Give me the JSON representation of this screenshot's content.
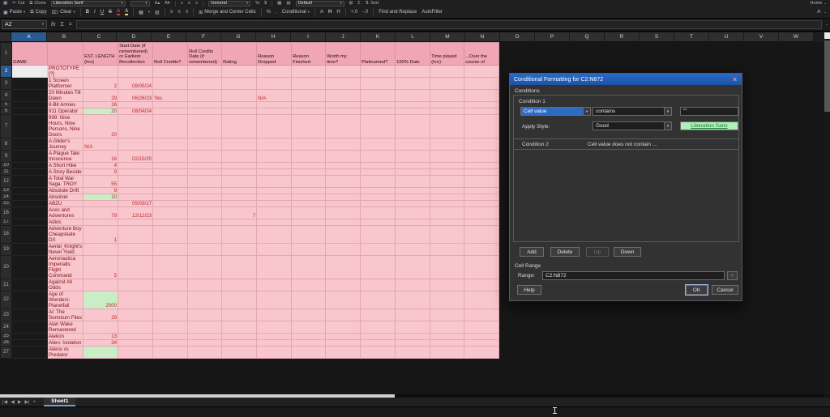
{
  "icons": {
    "grid": "▦",
    "cut": "✂",
    "clone": "⧉",
    "paste": "▣",
    "copy": "⧉",
    "clear": "⌦",
    "bold": "B",
    "italic": "I",
    "underline": "U",
    "strike": "S",
    "font_color": "A",
    "highlight": "A",
    "borders": "▦",
    "borders2": "▤",
    "merge_icon": "⊞",
    "align_left": "≡",
    "align_center": "≡",
    "align_right": "≡",
    "percent": "%",
    "comma": ",",
    "currency": "$",
    "sigma": "Σ",
    "sort": "⇅",
    "grow": "A▴",
    "shrink_font": "A▾",
    "add_decimal": "+.0",
    "del_decimal": "-.0",
    "chev": "▾",
    "chev2": "⌄",
    "fx": "fx",
    "eq": "=",
    "nav_first": "|◀",
    "nav_prev": "◀",
    "nav_next": "▶",
    "nav_last": "▶|",
    "add_sheet": "+",
    "close": "×",
    "shrink": "▫",
    "styleA": "A",
    "styleH1": "H",
    "styleH2": "H"
  },
  "toolbar1": {
    "cut": "Cut",
    "clone": "Clone",
    "font_name": "Liberation Serif",
    "font_size": "",
    "number_format": "General",
    "cell_style": "Default",
    "sort": "Sort",
    "home": "Home"
  },
  "toolbar2": {
    "paste": "Paste",
    "copy": "Copy",
    "clear": "Clear",
    "merge": "Merge and Center Cells",
    "conditional": "Conditional",
    "find_replace": "Find and Replace",
    "autofilter": "AutoFilter"
  },
  "formula_bar": {
    "name_box": "A2"
  },
  "sheet": {
    "selected_col": "A",
    "selected_row": "2",
    "col_letters": [
      "A",
      "B",
      "C",
      "D",
      "E",
      "F",
      "G",
      "H",
      "I",
      "J",
      "K",
      "L",
      "M",
      "N",
      "O",
      "P",
      "Q",
      "R",
      "S",
      "T",
      "U",
      "V",
      "W"
    ],
    "col_headers": [
      "GAME",
      "",
      "EST. LENGTH (hrs)",
      "Start Date (if remembered) or Earliest Recollection",
      "Roll Credits?",
      "Roll Credits Date (if remembered)",
      "Rating",
      "Reason Dropped",
      "Reason Finished",
      "Worth my time?",
      "Platinumed?",
      "100% Date",
      "Time played (hrs)",
      "...Over the course of"
    ],
    "rows": [
      {
        "n": "2",
        "name": "PROTOTYPE [?]"
      },
      {
        "n": "3",
        "name": "1 Screen Platformer",
        "est": "2",
        "start": "08/05/24"
      },
      {
        "n": "4",
        "name": "20 Minutes Till Dawn",
        "est": "29",
        "start": "06/26/23",
        "roll": "Yes",
        "drop": "N/A"
      },
      {
        "n": "5",
        "name": "8-Bit Armies",
        "est": "16"
      },
      {
        "n": "6",
        "name": "911 Operator",
        "est": "20",
        "g": true,
        "start": "08/04/24"
      },
      {
        "n": "7",
        "name": "999: Nine Hours, Nine Persons, Nine Doors",
        "est": "20"
      },
      {
        "n": "8",
        "name": "A Glider's Journey",
        "est": "N/A"
      },
      {
        "n": "9",
        "name": "A Plague Tale: Innocence",
        "est": "16",
        "start": "02/15/20"
      },
      {
        "n": "10",
        "name": "A Short Hike",
        "est": "4"
      },
      {
        "n": "11",
        "name": "A Story Beside",
        "est": "9"
      },
      {
        "n": "12",
        "name": "A Total War Saga: TROY",
        "est": "55"
      },
      {
        "n": "13",
        "name": "Absolute Drift",
        "est": "9"
      },
      {
        "n": "14",
        "name": "Absolver",
        "est": "10",
        "g": true
      },
      {
        "n": "15",
        "name": "ABZÛ",
        "start": "05/03/17"
      },
      {
        "n": "16",
        "name": "Aces and Adventures",
        "est": "79",
        "start": "12/12/23",
        "rating": "7"
      },
      {
        "n": "17",
        "name": "Adios"
      },
      {
        "n": "18",
        "name": "Adventure Boy Cheapskate DX",
        "est": "1"
      },
      {
        "n": "19",
        "name": "Aerial_Knight's Never Yield"
      },
      {
        "n": "20",
        "name": "Aeronautica Imperialis: Flight Command",
        "est": "5"
      },
      {
        "n": "21",
        "name": "Against All Odds"
      },
      {
        "n": "22",
        "name": "Age of Wonders: Planetfall",
        "est": "2000",
        "g": true
      },
      {
        "n": "23",
        "name": "AI: The Somnium Files",
        "est": "29"
      },
      {
        "n": "24",
        "name": "Alan Wake Remastered"
      },
      {
        "n": "25",
        "name": "Alekon",
        "est": "13"
      },
      {
        "n": "26",
        "name": "Alien: Isolation",
        "est": "34"
      },
      {
        "n": "27",
        "name": "Aliens vs Predator",
        "g": true
      }
    ]
  },
  "tabs": {
    "sheet1": "Sheet1"
  },
  "dialog": {
    "title": "Conditional Formatting for C2:N872",
    "conditions_label": "Conditions",
    "condition1_label": "Condition 1",
    "cond_type": "Cell value",
    "cond_op": "contains",
    "cond_value": "\"\"",
    "apply_style_label": "Apply Style:",
    "style_name": "Good",
    "style_preview": "Liberation Sans",
    "condition2_label": "Condition 2",
    "condition2_summary": "Cell value does not contain ...",
    "add": "Add",
    "delete": "Delete",
    "up": "Up",
    "down": "Down",
    "cell_range_label": "Cell Range",
    "range_label": "Range:",
    "range_value": "C2:N872",
    "help": "Help",
    "ok": "OK",
    "cancel": "Cancel"
  }
}
